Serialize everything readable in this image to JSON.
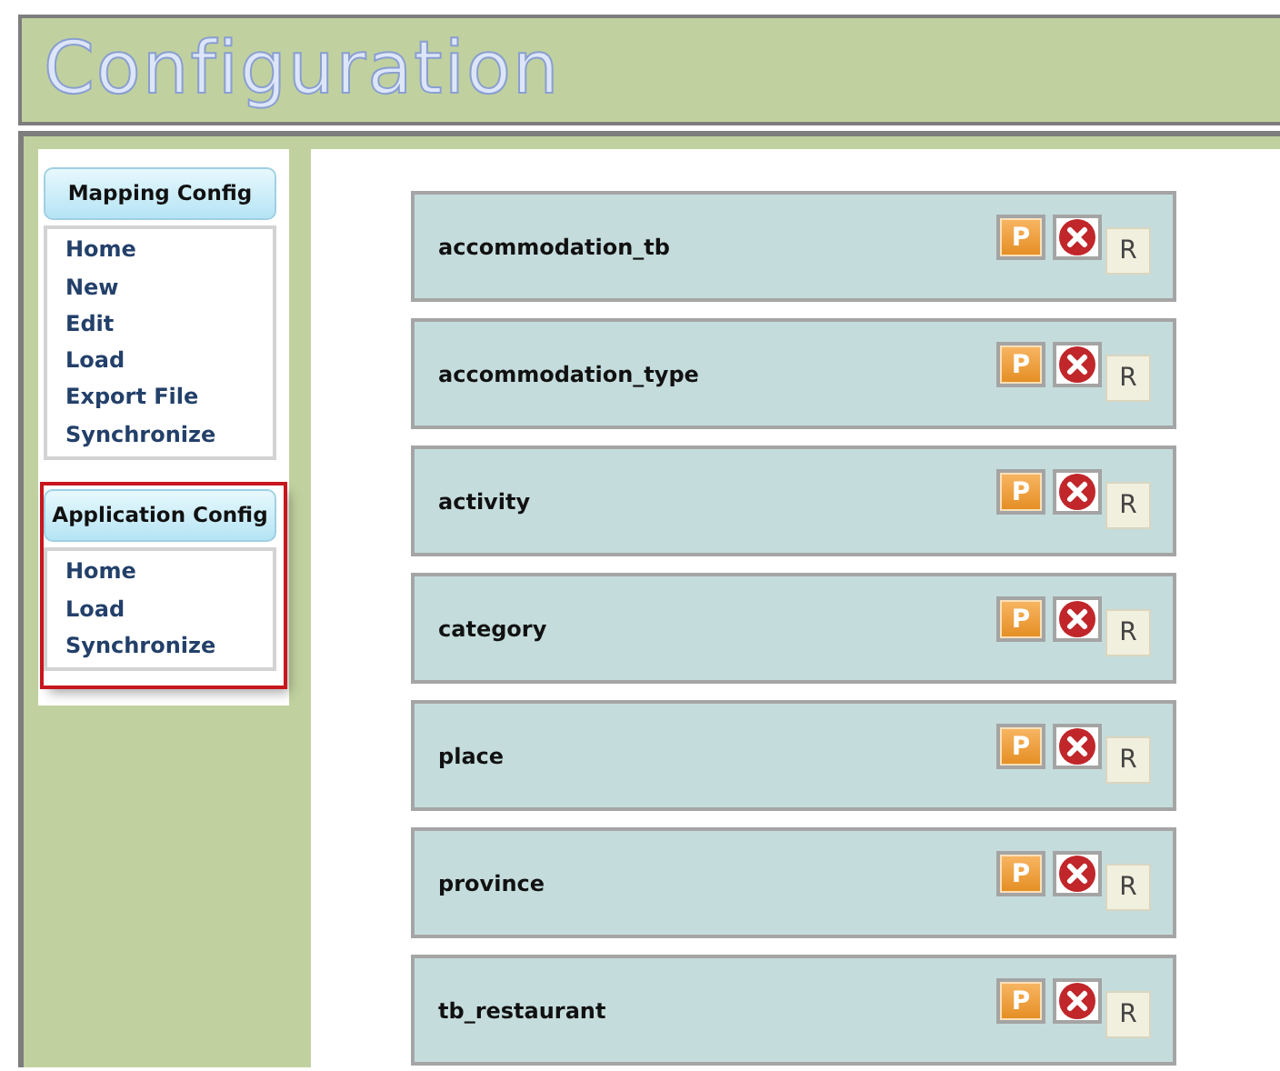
{
  "header": {
    "title": "Configuration"
  },
  "sidebar": {
    "groups": [
      {
        "title": "Mapping Config",
        "highlighted": false,
        "items": [
          "Home",
          "New",
          "Edit",
          "Load",
          "Export File",
          "Synchronize"
        ]
      },
      {
        "title": "Application Config",
        "highlighted": true,
        "items": [
          "Home",
          "Load",
          "Synchronize"
        ]
      }
    ]
  },
  "tables": [
    {
      "name": "accommodation_tb",
      "p_label": "P",
      "r_label": "R"
    },
    {
      "name": "accommodation_type",
      "p_label": "P",
      "r_label": "R"
    },
    {
      "name": "activity",
      "p_label": "P",
      "r_label": "R"
    },
    {
      "name": "category",
      "p_label": "P",
      "r_label": "R"
    },
    {
      "name": "place",
      "p_label": "P",
      "r_label": "R"
    },
    {
      "name": "province",
      "p_label": "P",
      "r_label": "R"
    },
    {
      "name": "tb_restaurant",
      "p_label": "P",
      "r_label": "R"
    }
  ]
}
